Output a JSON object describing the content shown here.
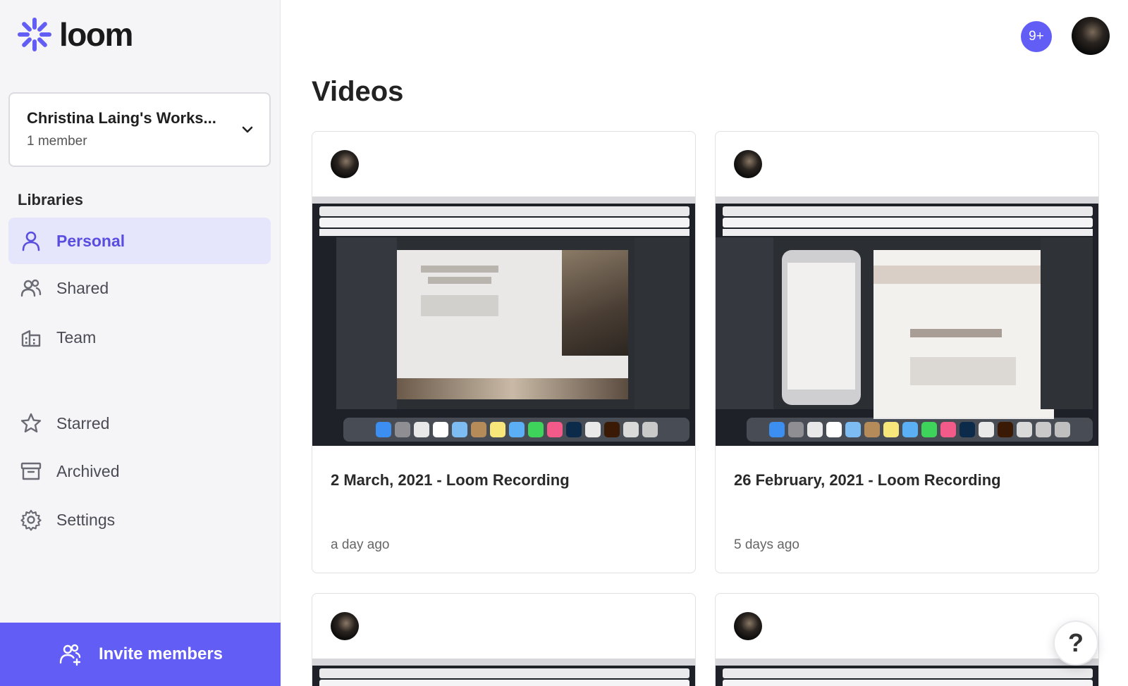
{
  "app": {
    "name": "loom",
    "brand_color": "#625df5"
  },
  "workspace": {
    "name": "Christina Laing's Works...",
    "members": "1 member"
  },
  "sidebar": {
    "libraries_heading": "Libraries",
    "items": [
      {
        "label": "Personal",
        "icon": "user-icon",
        "active": true
      },
      {
        "label": "Shared",
        "icon": "users-icon"
      },
      {
        "label": "Team",
        "icon": "building-icon"
      },
      {
        "label": "Starred",
        "icon": "star-icon"
      },
      {
        "label": "Archived",
        "icon": "archive-icon"
      },
      {
        "label": "Settings",
        "icon": "gear-icon"
      }
    ],
    "invite_label": "Invite members"
  },
  "header": {
    "notifications": "9+"
  },
  "main": {
    "title": "Videos",
    "videos": [
      {
        "title": "2 March, 2021 - Loom Recording",
        "time": "a day ago"
      },
      {
        "title": "26 February, 2021 - Loom Recording",
        "time": "5 days ago"
      },
      {
        "title": "",
        "time": ""
      },
      {
        "title": "",
        "time": ""
      }
    ]
  },
  "help": {
    "label": "?"
  }
}
